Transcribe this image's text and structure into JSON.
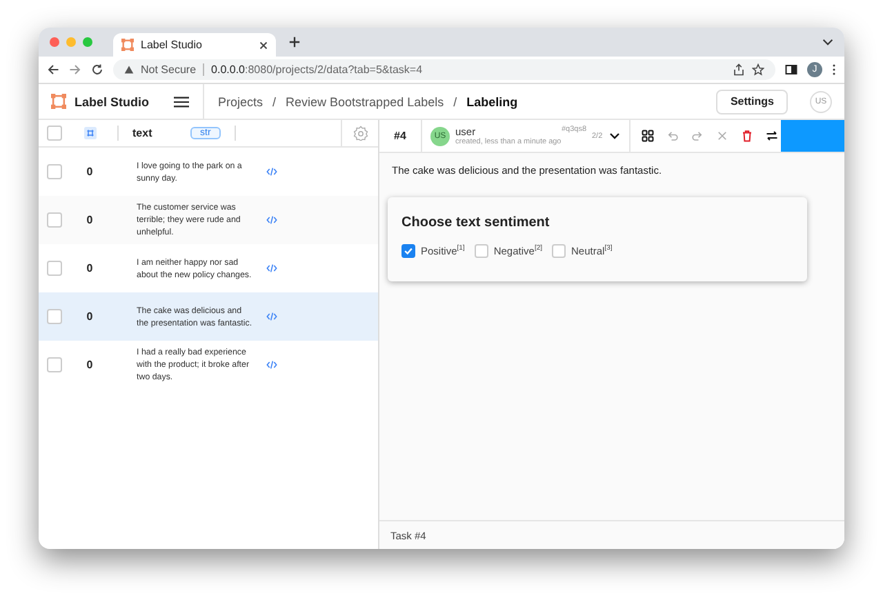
{
  "browser": {
    "tab_title": "Label Studio",
    "security": "Not Secure",
    "url_host": "0.0.0.0",
    "url_path": ":8080/projects/2/data?tab=5&task=4",
    "profile_initial": "J"
  },
  "app": {
    "logo_text": "Label Studio",
    "breadcrumb_separator": "/",
    "breadcrumbs": [
      {
        "label": "Projects",
        "current": false
      },
      {
        "label": "Review Bootstrapped Labels",
        "current": false
      },
      {
        "label": "Labeling",
        "current": true
      }
    ],
    "settings_button": "Settings",
    "user_initials": "US"
  },
  "table": {
    "select_all_checked": false,
    "columns": [
      {
        "label": "text",
        "type_badge": "str"
      }
    ],
    "rows": [
      {
        "count": "0",
        "text": "I love going to the park on a sunny day.",
        "checked": false,
        "selected": false
      },
      {
        "count": "0",
        "text": "The customer service was terrible; they were rude and unhelpful.",
        "checked": false,
        "selected": false
      },
      {
        "count": "0",
        "text": "I am neither happy nor sad about the new policy changes.",
        "checked": false,
        "selected": false
      },
      {
        "count": "0",
        "text": "The cake was delicious and the presentation was fantastic.",
        "checked": false,
        "selected": true
      },
      {
        "count": "0",
        "text": "I had a really bad experience with the product; it broke after two days.",
        "checked": false,
        "selected": false
      }
    ]
  },
  "annotation": {
    "task_id": "#4",
    "user_initials": "US",
    "user": "user",
    "created": "created, less than a minute ago",
    "annotation_id": "#q3qs8",
    "counter": "2/2"
  },
  "task_text": "The cake was delicious and the presentation was fantastic.",
  "choices": {
    "title": "Choose text sentiment",
    "options": [
      {
        "label": "Positive$^{[1]}$",
        "checked": true
      },
      {
        "label": "Negative$^{[2]}$",
        "checked": false
      },
      {
        "label": "Neutral$^{[3]}$",
        "checked": false
      }
    ]
  },
  "footer": "Task #4"
}
